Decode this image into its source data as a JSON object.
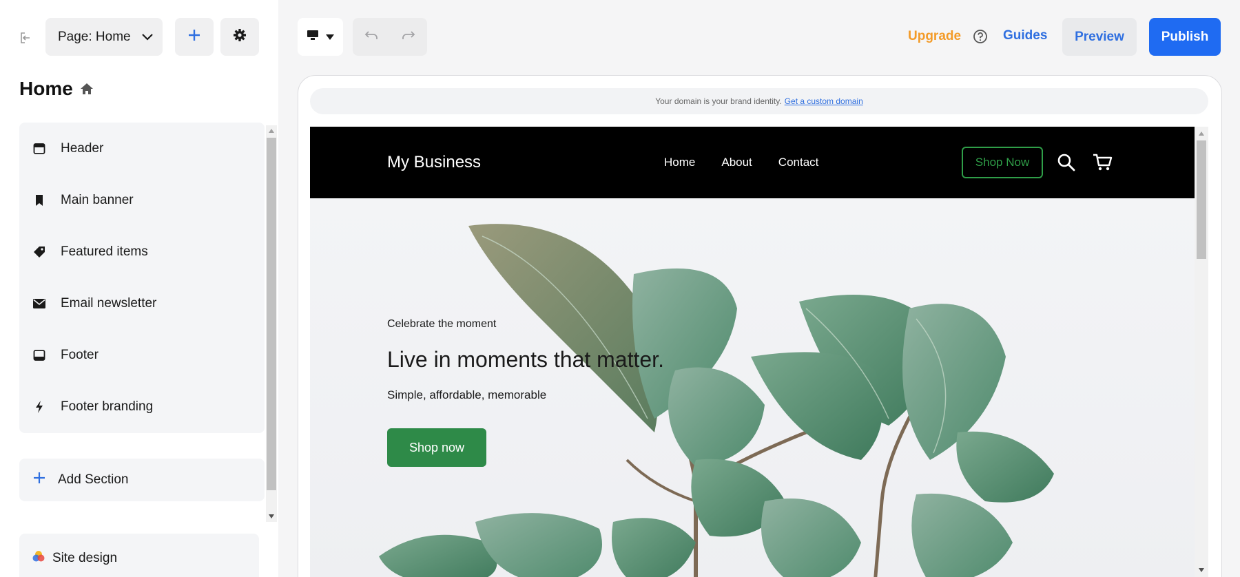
{
  "topbar": {
    "page_select_label": "Page: Home",
    "upgrade_label": "Upgrade",
    "guides_label": "Guides",
    "preview_label": "Preview",
    "publish_label": "Publish"
  },
  "sidebar": {
    "page_title": "Home",
    "sections": [
      {
        "label": "Header",
        "icon": "header-icon"
      },
      {
        "label": "Main banner",
        "icon": "bookmark-icon"
      },
      {
        "label": "Featured items",
        "icon": "tag-icon"
      },
      {
        "label": "Email newsletter",
        "icon": "envelope-icon"
      },
      {
        "label": "Footer",
        "icon": "footer-icon"
      },
      {
        "label": "Footer branding",
        "icon": "lightning-icon"
      }
    ],
    "add_section_label": "Add Section",
    "site_design_label": "Site design"
  },
  "canvas": {
    "domain_notice": "Your domain is your brand identity.",
    "domain_link": "Get a custom domain"
  },
  "site": {
    "logo": "My Business",
    "nav": [
      "Home",
      "About",
      "Contact"
    ],
    "header_cta": "Shop Now",
    "hero": {
      "eyebrow": "Celebrate the moment",
      "title": "Live in moments that matter.",
      "subtitle": "Simple, affordable, memorable",
      "cta": "Shop now"
    }
  },
  "colors": {
    "accent_blue": "#1f6bf2",
    "upgrade_orange": "#f39b28",
    "site_green": "#2e8a48"
  }
}
